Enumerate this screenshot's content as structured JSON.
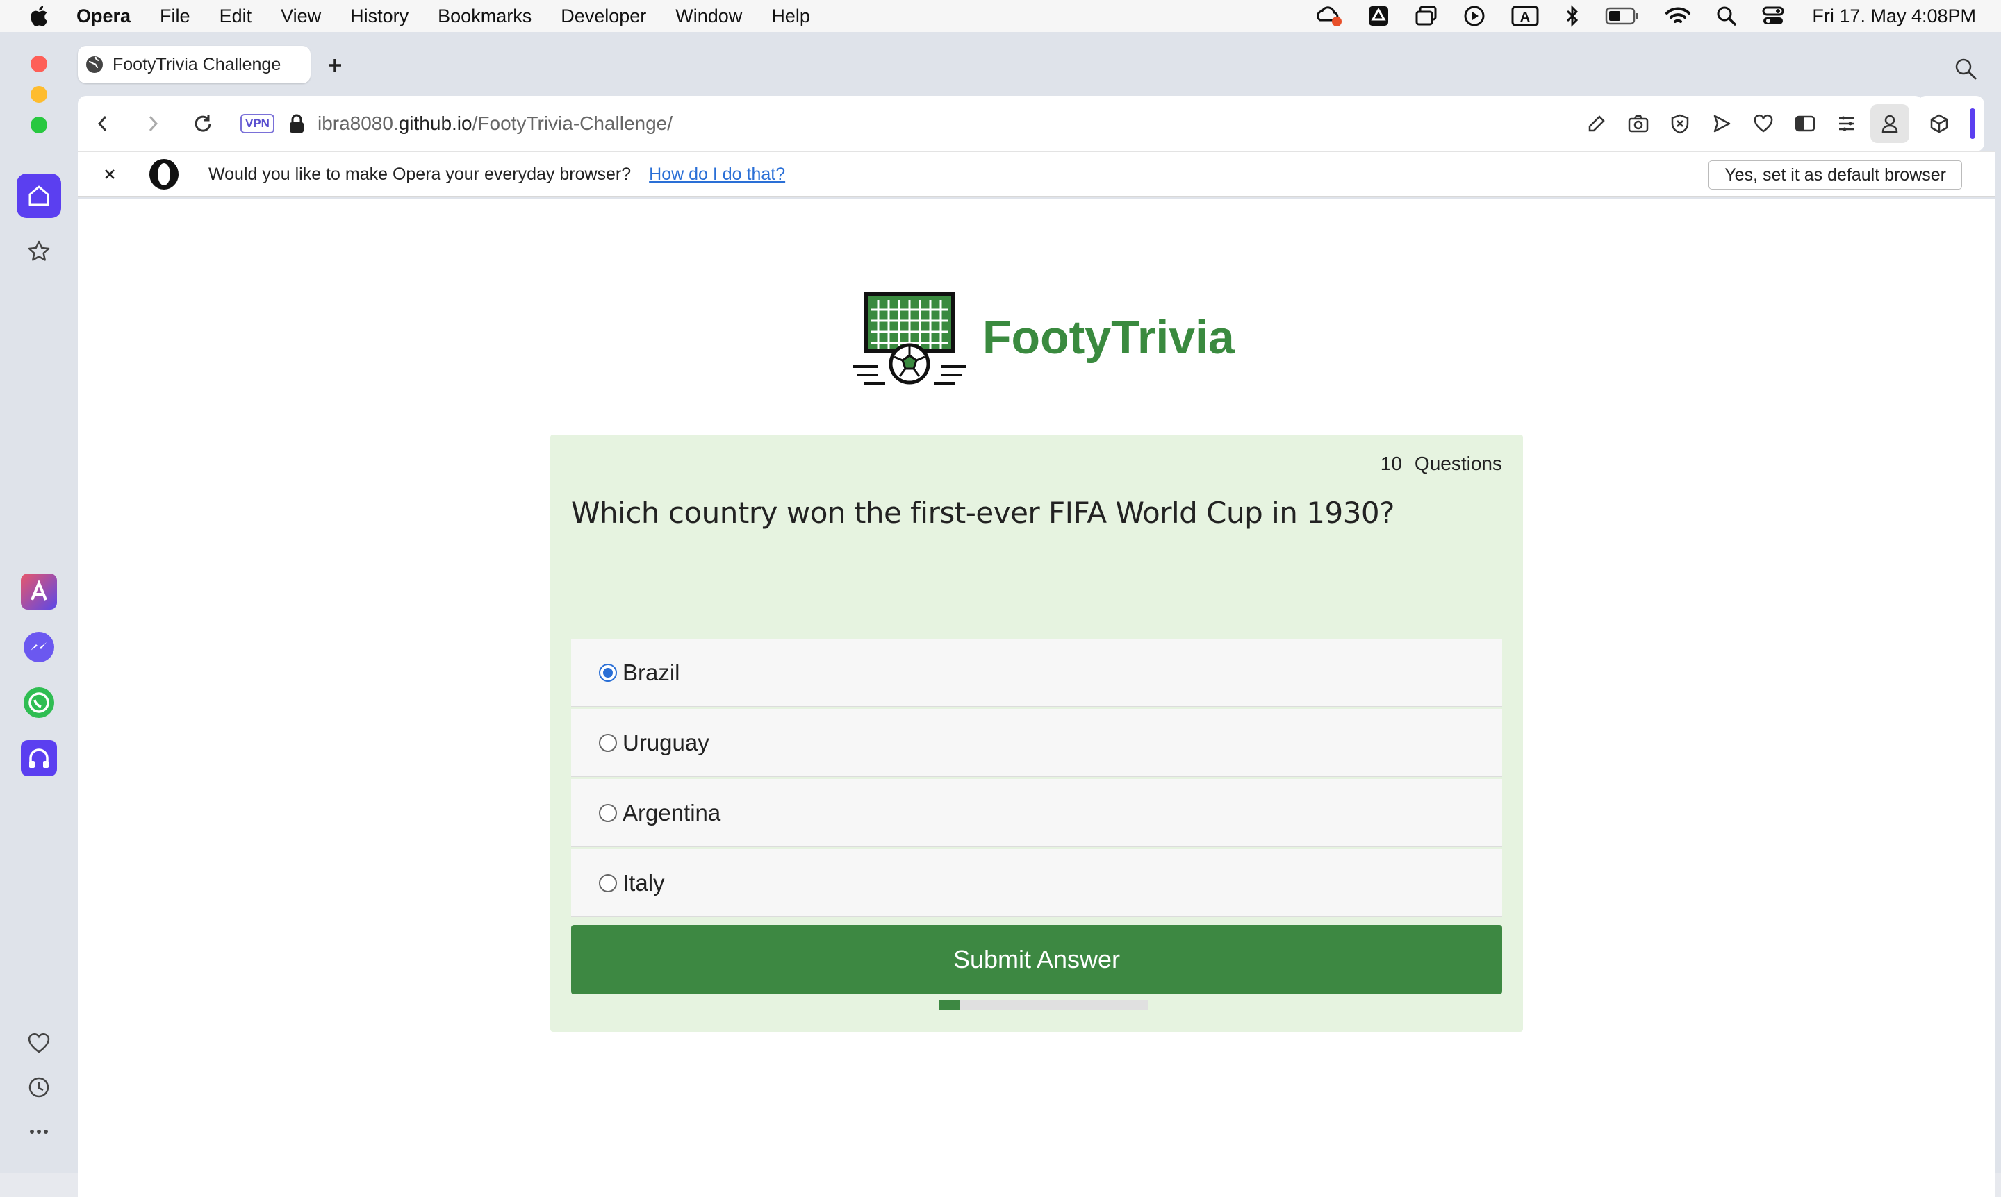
{
  "menubar": {
    "app": "Opera",
    "items": [
      "File",
      "Edit",
      "View",
      "History",
      "Bookmarks",
      "Developer",
      "Window",
      "Help"
    ],
    "clock": "Fri 17. May  4:08PM"
  },
  "tab": {
    "title": "FootyTrivia Challenge"
  },
  "address": {
    "host_prefix": "ibra8080.",
    "host": "github.io",
    "path": "/FootyTrivia-Challenge/",
    "vpn": "VPN"
  },
  "infobar": {
    "message": "Would you like to make Opera your everyday browser?",
    "link": "How do I do that?",
    "button": "Yes, set it as default browser"
  },
  "page": {
    "brand": "FootyTrivia",
    "question_count": "10",
    "question_count_label": "Questions",
    "question": "Which country won the first-ever FIFA World Cup in 1930?",
    "options": [
      {
        "label": "Brazil",
        "checked": true
      },
      {
        "label": "Uruguay",
        "checked": false
      },
      {
        "label": "Argentina",
        "checked": false
      },
      {
        "label": "Italy",
        "checked": false
      }
    ],
    "submit": "Submit Answer",
    "progress_fraction": 0.1
  },
  "colors": {
    "accent": "#3d8842",
    "card_bg": "#e6f3e0",
    "link": "#2a6fd6"
  }
}
